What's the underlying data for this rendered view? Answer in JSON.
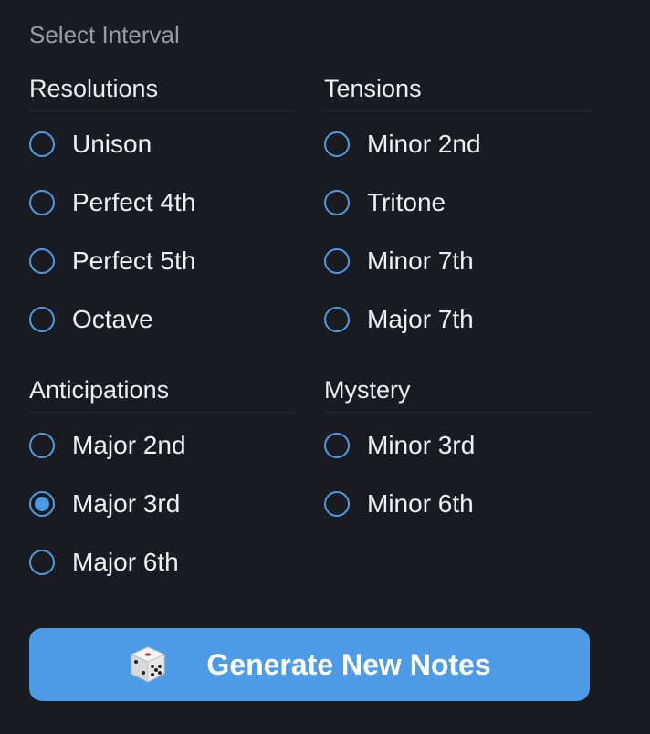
{
  "title": "Select Interval",
  "groups": [
    {
      "heading": "Resolutions",
      "options": [
        {
          "label": "Unison",
          "checked": false
        },
        {
          "label": "Perfect 4th",
          "checked": false
        },
        {
          "label": "Perfect 5th",
          "checked": false
        },
        {
          "label": "Octave",
          "checked": false
        }
      ]
    },
    {
      "heading": "Tensions",
      "options": [
        {
          "label": "Minor 2nd",
          "checked": false
        },
        {
          "label": "Tritone",
          "checked": false
        },
        {
          "label": "Minor 7th",
          "checked": false
        },
        {
          "label": "Major 7th",
          "checked": false
        }
      ]
    },
    {
      "heading": "Anticipations",
      "options": [
        {
          "label": "Major 2nd",
          "checked": false
        },
        {
          "label": "Major 3rd",
          "checked": true
        },
        {
          "label": "Major 6th",
          "checked": false
        }
      ]
    },
    {
      "heading": "Mystery",
      "options": [
        {
          "label": "Minor 3rd",
          "checked": false
        },
        {
          "label": "Minor 6th",
          "checked": false
        }
      ]
    }
  ],
  "button": {
    "label": "Generate New Notes",
    "icon": "dice-icon"
  },
  "colors": {
    "background": "#1a1b20",
    "accent": "#4d9be6",
    "muted_text": "#9b9ca3"
  }
}
